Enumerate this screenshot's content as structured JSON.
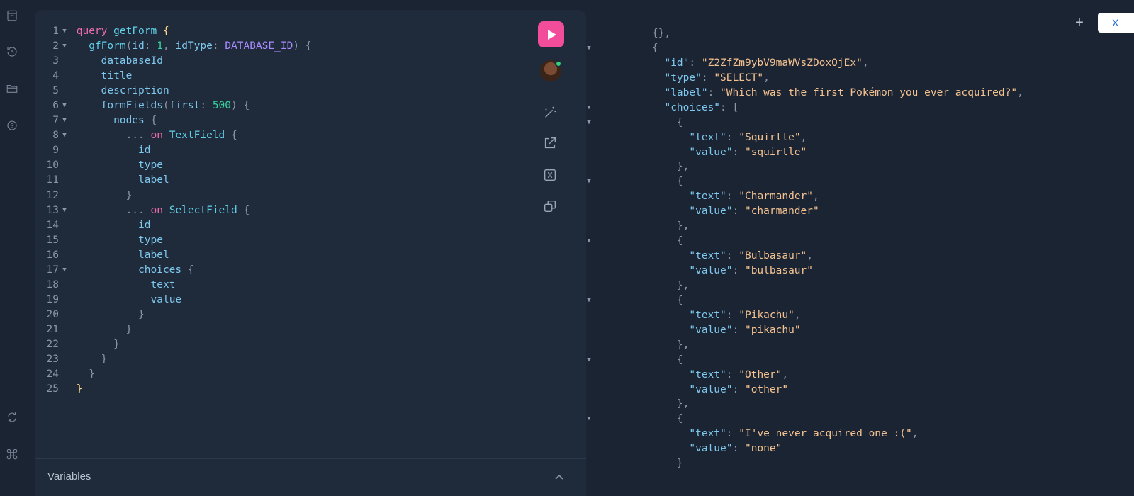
{
  "sidebar": {
    "items": [
      {
        "icon": "docs-icon"
      },
      {
        "icon": "history-icon"
      },
      {
        "icon": "folder-icon"
      },
      {
        "icon": "help-icon"
      },
      {
        "icon": "refresh-icon"
      },
      {
        "icon": "command-icon"
      }
    ]
  },
  "editor": {
    "lines": [
      {
        "n": "1",
        "fold": true
      },
      {
        "n": "2",
        "fold": true
      },
      {
        "n": "3",
        "fold": false
      },
      {
        "n": "4",
        "fold": false
      },
      {
        "n": "5",
        "fold": false
      },
      {
        "n": "6",
        "fold": true
      },
      {
        "n": "7",
        "fold": true
      },
      {
        "n": "8",
        "fold": true
      },
      {
        "n": "9",
        "fold": false
      },
      {
        "n": "10",
        "fold": false
      },
      {
        "n": "11",
        "fold": false
      },
      {
        "n": "12",
        "fold": false
      },
      {
        "n": "13",
        "fold": true
      },
      {
        "n": "14",
        "fold": false
      },
      {
        "n": "15",
        "fold": false
      },
      {
        "n": "16",
        "fold": false
      },
      {
        "n": "17",
        "fold": true
      },
      {
        "n": "18",
        "fold": false
      },
      {
        "n": "19",
        "fold": false
      },
      {
        "n": "20",
        "fold": false
      },
      {
        "n": "21",
        "fold": false
      },
      {
        "n": "22",
        "fold": false
      },
      {
        "n": "23",
        "fold": false
      },
      {
        "n": "24",
        "fold": false
      },
      {
        "n": "25",
        "fold": false
      }
    ],
    "tokens": {
      "query": "query",
      "getForm": "getForm",
      "gfForm": "gfForm",
      "id_arg": "id",
      "id_val": "1",
      "idType_arg": "idType",
      "idType_val": "DATABASE_ID",
      "databaseId": "databaseId",
      "title": "title",
      "description": "description",
      "formFields": "formFields",
      "first_arg": "first",
      "first_val": "500",
      "nodes": "nodes",
      "spread": "...",
      "on": "on",
      "TextField": "TextField",
      "SelectField": "SelectField",
      "id": "id",
      "type": "type",
      "label": "label",
      "choices": "choices",
      "text": "text",
      "value": "value"
    },
    "variables_label": "Variables"
  },
  "toolbar": {
    "run_icon": "play-icon",
    "avatar_icon": "avatar",
    "prettify_icon": "magic-wand-icon",
    "share_icon": "external-link-icon",
    "merge_icon": "merge-fragments-icon",
    "copy_icon": "copy-icon"
  },
  "result": {
    "top_partial": "{},",
    "field": {
      "id_key": "\"id\"",
      "id_val": "\"Z2ZfZm9ybV9maWVsZDoxOjEx\"",
      "type_key": "\"type\"",
      "type_val": "\"SELECT\"",
      "label_key": "\"label\"",
      "label_val": "\"Which was the first Pokémon you ever acquired?\"",
      "choices_key": "\"choices\""
    },
    "choices": [
      {
        "text": "\"Squirtle\"",
        "value": "\"squirtle\""
      },
      {
        "text": "\"Charmander\"",
        "value": "\"charmander\""
      },
      {
        "text": "\"Bulbasaur\"",
        "value": "\"bulbasaur\""
      },
      {
        "text": "\"Pikachu\"",
        "value": "\"pikachu\""
      },
      {
        "text": "\"Other\"",
        "value": "\"other\""
      },
      {
        "text": "\"I've never acquired one :(\"",
        "value": "\"none\""
      }
    ],
    "text_key": "\"text\"",
    "value_key": "\"value\""
  },
  "header": {
    "add_tab_label": "+",
    "close_label": "X"
  }
}
